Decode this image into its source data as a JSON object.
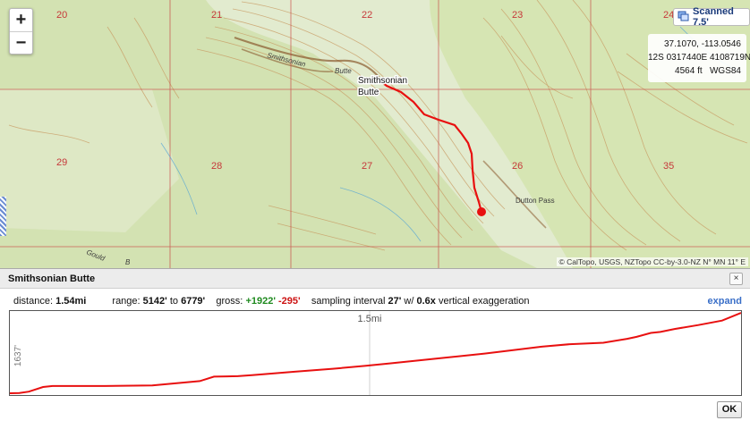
{
  "map": {
    "zoom_in": "+",
    "zoom_out": "−",
    "layer_label": "Scanned 7.5'",
    "coords": {
      "latlon": "37.1070, -113.0546",
      "utm": "12S 0317440E 4108719N",
      "elev": "4564 ft",
      "datum": "WGS84"
    },
    "section_numbers": [
      "20",
      "21",
      "22",
      "23",
      "24",
      "29",
      "28",
      "27",
      "26",
      "35"
    ],
    "features": {
      "butte_label_1": "Smithsonian",
      "butte_label_2": "Butte",
      "dutton_pass": "Dutton Pass",
      "gould": "Gould",
      "map_text_smithsonian": "Smithsonian",
      "map_text_butte": "Butte",
      "map_text_b": "B"
    },
    "attribution": "© CalTopo, USGS, NZTopo CC-by-3.0-NZ  N° MN 11° E",
    "icons": {
      "layer": "layers-icon",
      "handle": "resize-handle-icon"
    }
  },
  "panel": {
    "title": "Smithsonian Butte",
    "close": "×",
    "distance_label": "distance:",
    "distance_value": "1.54mi",
    "range_label": "range:",
    "range_low": "5142'",
    "range_to": "to",
    "range_high": "6779'",
    "gross_label": "gross:",
    "gross_gain": "+1922'",
    "gross_loss": "-295'",
    "sampling_label": "sampling interval",
    "sampling_value": "27'",
    "sampling_w": "w/",
    "exaggeration_value": "0.6x",
    "exaggeration_label": "vertical exaggeration",
    "expand": "expand",
    "ok": "OK",
    "colors": {
      "profile": "#e81010",
      "gain": "#1f8a1f",
      "loss": "#cc1111",
      "link": "#3a6fc8"
    }
  },
  "chart_data": {
    "type": "line",
    "ylabel": "1637'",
    "x_marker_label": "1.5mi",
    "x_unit": "mi",
    "y_unit": "ft",
    "xlim": [
      0,
      1.54
    ],
    "ylim": [
      5142,
      6779
    ],
    "series": [
      {
        "x": [
          0,
          0.02,
          0.04,
          0.07,
          0.09,
          0.12,
          0.2,
          0.3,
          0.4,
          0.43,
          0.48,
          0.51,
          0.6,
          0.68,
          0.75,
          0.8,
          0.9,
          1.0,
          1.06,
          1.12,
          1.18,
          1.25,
          1.3,
          1.32,
          1.35,
          1.37,
          1.4,
          1.45,
          1.5,
          1.54
        ],
        "y": [
          5142,
          5148,
          5175,
          5270,
          5290,
          5290,
          5290,
          5300,
          5390,
          5480,
          5490,
          5510,
          5580,
          5640,
          5700,
          5750,
          5850,
          5950,
          6020,
          6090,
          6140,
          6170,
          6250,
          6290,
          6370,
          6390,
          6450,
          6530,
          6620,
          6779
        ]
      }
    ]
  }
}
